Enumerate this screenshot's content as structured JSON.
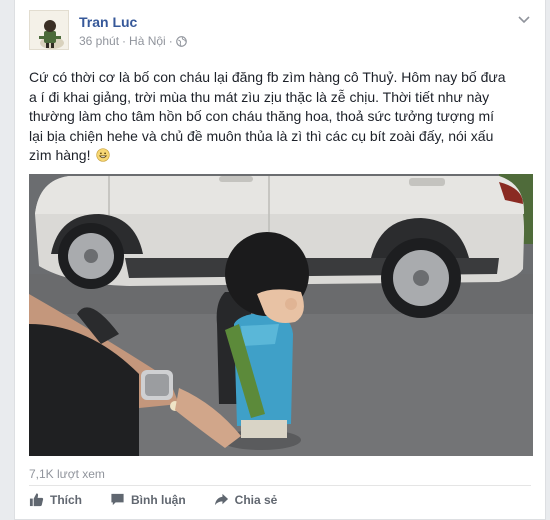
{
  "post": {
    "author": "Tran Luc",
    "time": "36 phút",
    "separator": "·",
    "location": "Hà Nội",
    "privacy_icon": "globe-icon",
    "text_lines": [
      "Cứ có thời cơ là bố con cháu lại đăng fb zìm hàng cô Thuỷ. Hôm nay bố đưa",
      "a í đi khai giảng, trời mùa thu mát zìu zịu thặc là zễ chịu. Thời tiết như này",
      "thường làm cho tâm hồn bố con cháu thăng hoa, thoả sức tưởng tượng mí",
      "lại bịa chiện hehe và chủ đề muôn thủa là zì thì các cụ bít zoài đấy, nói xấu",
      "zìm hàng!"
    ],
    "emoji_icon": "grinning-face-icon",
    "views": "7,1K lượt xem"
  },
  "actions": {
    "like": "Thích",
    "comment": "Bình luận",
    "share": "Chia sẻ"
  },
  "colors": {
    "link": "#365899",
    "meta": "#90949c",
    "action": "#616770"
  }
}
